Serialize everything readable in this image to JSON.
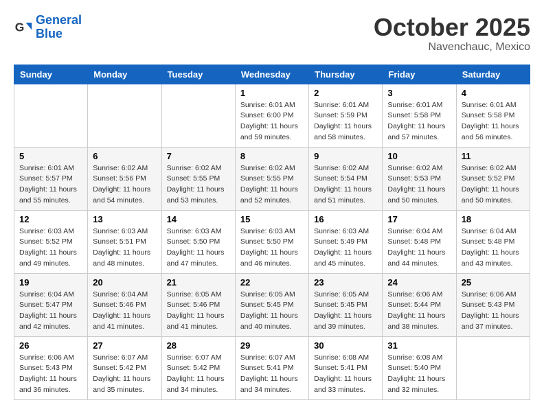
{
  "logo": {
    "line1": "General",
    "line2": "Blue"
  },
  "title": "October 2025",
  "location": "Navenchauc, Mexico",
  "weekdays": [
    "Sunday",
    "Monday",
    "Tuesday",
    "Wednesday",
    "Thursday",
    "Friday",
    "Saturday"
  ],
  "weeks": [
    [
      null,
      null,
      null,
      {
        "day": "1",
        "sunrise": "6:01 AM",
        "sunset": "6:00 PM",
        "daylight": "11 hours and 59 minutes."
      },
      {
        "day": "2",
        "sunrise": "6:01 AM",
        "sunset": "5:59 PM",
        "daylight": "11 hours and 58 minutes."
      },
      {
        "day": "3",
        "sunrise": "6:01 AM",
        "sunset": "5:58 PM",
        "daylight": "11 hours and 57 minutes."
      },
      {
        "day": "4",
        "sunrise": "6:01 AM",
        "sunset": "5:58 PM",
        "daylight": "11 hours and 56 minutes."
      }
    ],
    [
      {
        "day": "5",
        "sunrise": "6:01 AM",
        "sunset": "5:57 PM",
        "daylight": "11 hours and 55 minutes."
      },
      {
        "day": "6",
        "sunrise": "6:02 AM",
        "sunset": "5:56 PM",
        "daylight": "11 hours and 54 minutes."
      },
      {
        "day": "7",
        "sunrise": "6:02 AM",
        "sunset": "5:55 PM",
        "daylight": "11 hours and 53 minutes."
      },
      {
        "day": "8",
        "sunrise": "6:02 AM",
        "sunset": "5:55 PM",
        "daylight": "11 hours and 52 minutes."
      },
      {
        "day": "9",
        "sunrise": "6:02 AM",
        "sunset": "5:54 PM",
        "daylight": "11 hours and 51 minutes."
      },
      {
        "day": "10",
        "sunrise": "6:02 AM",
        "sunset": "5:53 PM",
        "daylight": "11 hours and 50 minutes."
      },
      {
        "day": "11",
        "sunrise": "6:02 AM",
        "sunset": "5:52 PM",
        "daylight": "11 hours and 50 minutes."
      }
    ],
    [
      {
        "day": "12",
        "sunrise": "6:03 AM",
        "sunset": "5:52 PM",
        "daylight": "11 hours and 49 minutes."
      },
      {
        "day": "13",
        "sunrise": "6:03 AM",
        "sunset": "5:51 PM",
        "daylight": "11 hours and 48 minutes."
      },
      {
        "day": "14",
        "sunrise": "6:03 AM",
        "sunset": "5:50 PM",
        "daylight": "11 hours and 47 minutes."
      },
      {
        "day": "15",
        "sunrise": "6:03 AM",
        "sunset": "5:50 PM",
        "daylight": "11 hours and 46 minutes."
      },
      {
        "day": "16",
        "sunrise": "6:03 AM",
        "sunset": "5:49 PM",
        "daylight": "11 hours and 45 minutes."
      },
      {
        "day": "17",
        "sunrise": "6:04 AM",
        "sunset": "5:48 PM",
        "daylight": "11 hours and 44 minutes."
      },
      {
        "day": "18",
        "sunrise": "6:04 AM",
        "sunset": "5:48 PM",
        "daylight": "11 hours and 43 minutes."
      }
    ],
    [
      {
        "day": "19",
        "sunrise": "6:04 AM",
        "sunset": "5:47 PM",
        "daylight": "11 hours and 42 minutes."
      },
      {
        "day": "20",
        "sunrise": "6:04 AM",
        "sunset": "5:46 PM",
        "daylight": "11 hours and 41 minutes."
      },
      {
        "day": "21",
        "sunrise": "6:05 AM",
        "sunset": "5:46 PM",
        "daylight": "11 hours and 41 minutes."
      },
      {
        "day": "22",
        "sunrise": "6:05 AM",
        "sunset": "5:45 PM",
        "daylight": "11 hours and 40 minutes."
      },
      {
        "day": "23",
        "sunrise": "6:05 AM",
        "sunset": "5:45 PM",
        "daylight": "11 hours and 39 minutes."
      },
      {
        "day": "24",
        "sunrise": "6:06 AM",
        "sunset": "5:44 PM",
        "daylight": "11 hours and 38 minutes."
      },
      {
        "day": "25",
        "sunrise": "6:06 AM",
        "sunset": "5:43 PM",
        "daylight": "11 hours and 37 minutes."
      }
    ],
    [
      {
        "day": "26",
        "sunrise": "6:06 AM",
        "sunset": "5:43 PM",
        "daylight": "11 hours and 36 minutes."
      },
      {
        "day": "27",
        "sunrise": "6:07 AM",
        "sunset": "5:42 PM",
        "daylight": "11 hours and 35 minutes."
      },
      {
        "day": "28",
        "sunrise": "6:07 AM",
        "sunset": "5:42 PM",
        "daylight": "11 hours and 34 minutes."
      },
      {
        "day": "29",
        "sunrise": "6:07 AM",
        "sunset": "5:41 PM",
        "daylight": "11 hours and 34 minutes."
      },
      {
        "day": "30",
        "sunrise": "6:08 AM",
        "sunset": "5:41 PM",
        "daylight": "11 hours and 33 minutes."
      },
      {
        "day": "31",
        "sunrise": "6:08 AM",
        "sunset": "5:40 PM",
        "daylight": "11 hours and 32 minutes."
      },
      null
    ]
  ]
}
